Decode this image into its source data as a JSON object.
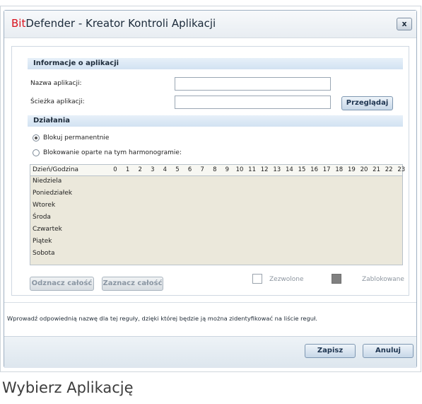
{
  "window": {
    "title_brand": "Bit",
    "title_rest": "Defender - Kreator Kontroli Aplikacji",
    "close_label": "x"
  },
  "app_info": {
    "header": "Informacje o aplikacji",
    "name_label": "Nazwa aplikacji:",
    "name_value": "",
    "path_label": "Ścieżka aplikacji:",
    "path_value": "",
    "browse_label": "Przeglądaj"
  },
  "actions": {
    "header": "Działania",
    "option_permanent": "Blokuj permanentnie",
    "option_schedule": "Blokowanie oparte na tym harmonogramie:",
    "selected": "permanent"
  },
  "schedule": {
    "corner_label": "Dzień/Godzina",
    "hours": [
      "0",
      "1",
      "2",
      "3",
      "4",
      "5",
      "6",
      "7",
      "8",
      "9",
      "10",
      "11",
      "12",
      "13",
      "14",
      "15",
      "16",
      "17",
      "18",
      "19",
      "20",
      "21",
      "22",
      "23"
    ],
    "days": [
      "Niedziela",
      "Poniedziałek",
      "Wtorek",
      "Środa",
      "Czwartek",
      "Piątek",
      "Sobota"
    ]
  },
  "schedule_controls": {
    "deselect_all": "Odznacz całość",
    "select_all": "Zaznacz całość",
    "legend_allowed": "Zezwolone",
    "legend_blocked": "Zablokowane"
  },
  "hint": "Wprowadź odpowiednią nazwę dla tej reguły, dzięki której będzie ją można zidentyfikować na liście reguł.",
  "footer": {
    "save_label": "Zapisz",
    "cancel_label": "Anuluj"
  },
  "caption": "Wybierz Aplikację",
  "colors": {
    "brand_red": "#d8121e",
    "section_blue": "#d2e2f2",
    "schedule_bg": "#ebe8db",
    "blocked_gray": "#808080"
  }
}
